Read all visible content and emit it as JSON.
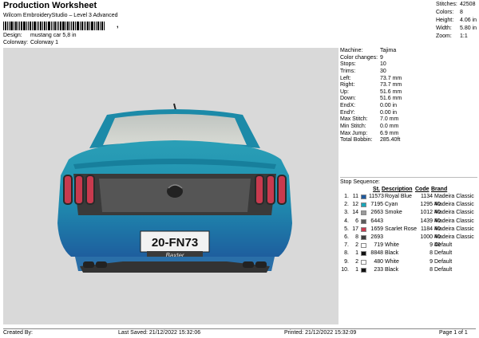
{
  "header": {
    "title": "Production Worksheet",
    "subtitle": "Wilcom EmbroideryStudio – Level 3 Advanced",
    "barcode_suffix": ",",
    "design_label": "Design:",
    "design_value": "mustang car 5,8 in",
    "colorway_label": "Colorway:",
    "colorway_value": "Colorway 1"
  },
  "summary": [
    {
      "label": "Stitches:",
      "value": "42508"
    },
    {
      "label": "Colors:",
      "value": "8"
    },
    {
      "label": "Height:",
      "value": "4.06 in"
    },
    {
      "label": "Width:",
      "value": "5.80 in"
    },
    {
      "label": "Zoom:",
      "value": "1:1"
    }
  ],
  "machine_info": [
    {
      "label": "Machine:",
      "value": "Tajima"
    },
    {
      "label": "Color changes:",
      "value": "9"
    },
    {
      "label": "Stops:",
      "value": "10"
    },
    {
      "label": "Trims:",
      "value": "30"
    },
    {
      "label": "Left:",
      "value": "73.7 mm"
    },
    {
      "label": "Right:",
      "value": "73.7 mm"
    },
    {
      "label": "Up:",
      "value": "51.6 mm"
    },
    {
      "label": "Down:",
      "value": "51.6 mm"
    },
    {
      "label": "EndX:",
      "value": "0.00 in"
    },
    {
      "label": "EndY:",
      "value": "0.00 in"
    },
    {
      "label": "Max Stitch:",
      "value": "7.0 mm"
    },
    {
      "label": "Min Stitch:",
      "value": "0.0 mm"
    },
    {
      "label": "Max Jump:",
      "value": "6.9 mm"
    },
    {
      "label": "Total Bobbin:",
      "value": "285.40ft"
    }
  ],
  "stop_sequence": {
    "title": "Stop Sequence:",
    "headers": {
      "stitches": "St.",
      "code": "Code",
      "description": "Description",
      "code2": "Code",
      "brand": "Brand"
    },
    "rows": [
      {
        "n": "1.",
        "stop": "11",
        "color": "#1f5a9e",
        "st": "11573",
        "desc": "Royal Blue",
        "code": "1134",
        "brand": "Madeira Classic 40"
      },
      {
        "n": "2.",
        "stop": "12",
        "color": "#1aa6b8",
        "st": "7195",
        "desc": "Cyan",
        "code": "1295",
        "brand": "Madeira Classic 40"
      },
      {
        "n": "3.",
        "stop": "14",
        "color": "#9a9a9a",
        "st": "2663",
        "desc": "Smoke",
        "code": "1012",
        "brand": "Madeira Classic 40"
      },
      {
        "n": "4.",
        "stop": "6",
        "color": "#5a5a5a",
        "st": "6443",
        "desc": "",
        "code": "1439",
        "brand": "Madeira Classic 40"
      },
      {
        "n": "5.",
        "stop": "17",
        "color": "#c83a4e",
        "st": "1659",
        "desc": "Scarlet Rose",
        "code": "1184",
        "brand": "Madeira Classic 40"
      },
      {
        "n": "6.",
        "stop": "8",
        "color": "#3e3e3e",
        "st": "2693",
        "desc": "",
        "code": "1000",
        "brand": "Madeira Classic 40"
      },
      {
        "n": "7.",
        "stop": "2",
        "color": "#ffffff",
        "st": "719",
        "desc": "White",
        "code": "9",
        "brand": "Default"
      },
      {
        "n": "8.",
        "stop": "1",
        "color": "#111111",
        "st": "8848",
        "desc": "Black",
        "code": "8",
        "brand": "Default"
      },
      {
        "n": "9.",
        "stop": "2",
        "color": "#ffffff",
        "st": "480",
        "desc": "White",
        "code": "9",
        "brand": "Default"
      },
      {
        "n": "10.",
        "stop": "1",
        "color": "#111111",
        "st": "233",
        "desc": "Black",
        "code": "8",
        "brand": "Default"
      }
    ]
  },
  "design_art": {
    "plate_text": "20-FN73",
    "plate_sub": "Baxter"
  },
  "footer": {
    "created_by": "Created By:",
    "last_saved": "Last Saved: 21/12/2022 15:32:06",
    "printed": "Printed: 21/12/2022 15:32:09",
    "page": "Page 1 of 1"
  }
}
